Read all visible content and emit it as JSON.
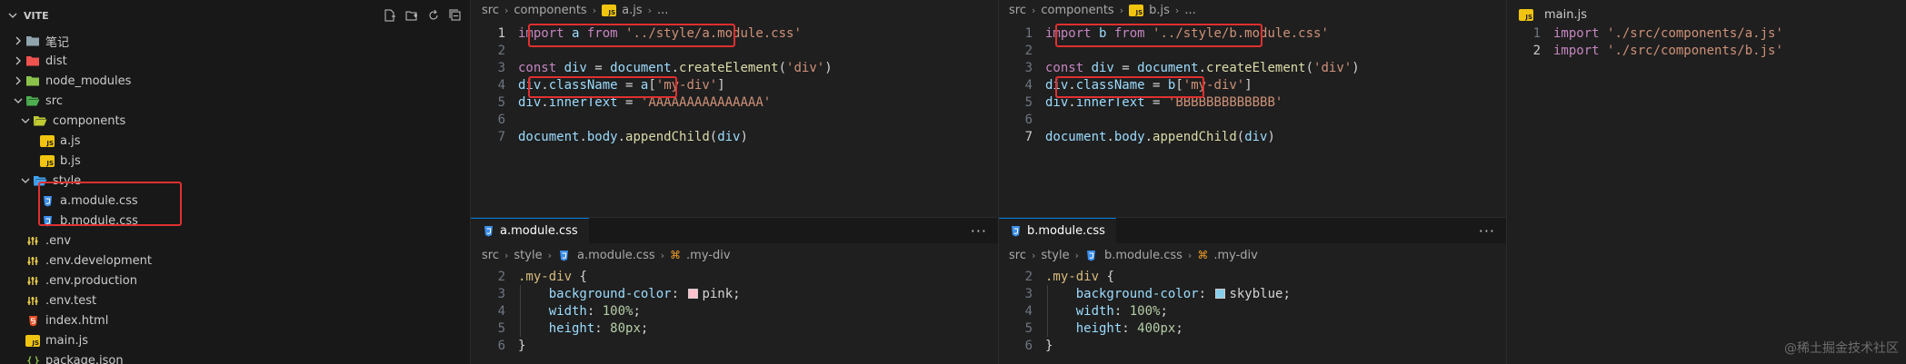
{
  "sidebar": {
    "title": "VITE",
    "actions": [
      "new-file-icon",
      "new-folder-icon",
      "refresh-icon",
      "collapse-icon"
    ],
    "items": [
      {
        "label": "笔记",
        "icon": "folder-icon",
        "kind": "folder-collapsed",
        "depth": 1
      },
      {
        "label": "dist",
        "icon": "folder-dist-icon",
        "kind": "folder-collapsed",
        "depth": 1
      },
      {
        "label": "node_modules",
        "icon": "folder-node-icon",
        "kind": "folder-collapsed",
        "depth": 1
      },
      {
        "label": "src",
        "icon": "folder-src-icon",
        "kind": "folder-open",
        "depth": 1
      },
      {
        "label": "components",
        "icon": "folder-components-icon",
        "kind": "folder-open",
        "depth": 2
      },
      {
        "label": "a.js",
        "icon": "js-file-icon",
        "kind": "file",
        "depth": 3
      },
      {
        "label": "b.js",
        "icon": "js-file-icon",
        "kind": "file",
        "depth": 3
      },
      {
        "label": "style",
        "icon": "folder-style-icon",
        "kind": "folder-open",
        "depth": 2
      },
      {
        "label": "a.module.css",
        "icon": "css-file-icon",
        "kind": "file",
        "depth": 3
      },
      {
        "label": "b.module.css",
        "icon": "css-file-icon",
        "kind": "file",
        "depth": 3
      },
      {
        "label": ".env",
        "icon": "env-file-icon",
        "kind": "file",
        "depth": 1
      },
      {
        "label": ".env.development",
        "icon": "env-file-icon",
        "kind": "file",
        "depth": 1
      },
      {
        "label": ".env.production",
        "icon": "env-file-icon",
        "kind": "file",
        "depth": 1
      },
      {
        "label": ".env.test",
        "icon": "env-file-icon",
        "kind": "file",
        "depth": 1
      },
      {
        "label": "index.html",
        "icon": "html-file-icon",
        "kind": "file",
        "depth": 1
      },
      {
        "label": "main.js",
        "icon": "js-file-icon",
        "kind": "file",
        "depth": 1
      },
      {
        "label": "package.json",
        "icon": "json-file-icon",
        "kind": "file",
        "depth": 1
      }
    ]
  },
  "editor_a_js": {
    "breadcrumb": [
      "src",
      "components",
      "a.js",
      "..."
    ],
    "lines": [
      {
        "n": "1",
        "parts": [
          [
            "kw",
            "import "
          ],
          [
            "var",
            "a "
          ],
          [
            "kw",
            "from "
          ],
          [
            "str",
            "'../style/a.module.css'"
          ]
        ]
      },
      {
        "n": "2",
        "parts": []
      },
      {
        "n": "3",
        "parts": [
          [
            "kw",
            "const "
          ],
          [
            "var",
            "div "
          ],
          [
            "pun",
            "= "
          ],
          [
            "var",
            "document"
          ],
          [
            "pun",
            "."
          ],
          [
            "fn",
            "createElement"
          ],
          [
            "pun",
            "("
          ],
          [
            "str",
            "'div'"
          ],
          [
            "pun",
            ")"
          ]
        ]
      },
      {
        "n": "4",
        "parts": [
          [
            "var",
            "div"
          ],
          [
            "pun",
            "."
          ],
          [
            "var",
            "className "
          ],
          [
            "pun",
            "= "
          ],
          [
            "var",
            "a"
          ],
          [
            "pun",
            "["
          ],
          [
            "str",
            "'my-div'"
          ],
          [
            "pun",
            "]"
          ]
        ]
      },
      {
        "n": "5",
        "parts": [
          [
            "var",
            "div"
          ],
          [
            "pun",
            "."
          ],
          [
            "var",
            "innerText "
          ],
          [
            "pun",
            "= "
          ],
          [
            "str",
            "'AAAAAAAAAAAAAAA'"
          ]
        ]
      },
      {
        "n": "6",
        "parts": []
      },
      {
        "n": "7",
        "parts": [
          [
            "var",
            "document"
          ],
          [
            "pun",
            "."
          ],
          [
            "var",
            "body"
          ],
          [
            "pun",
            "."
          ],
          [
            "fn",
            "appendChild"
          ],
          [
            "pun",
            "("
          ],
          [
            "var",
            "div"
          ],
          [
            "pun",
            ")"
          ]
        ]
      }
    ]
  },
  "editor_b_js": {
    "breadcrumb": [
      "src",
      "components",
      "b.js",
      "..."
    ],
    "lines": [
      {
        "n": "1",
        "parts": [
          [
            "kw",
            "import "
          ],
          [
            "var",
            "b "
          ],
          [
            "kw",
            "from "
          ],
          [
            "str",
            "'../style/b.module.css'"
          ]
        ]
      },
      {
        "n": "2",
        "parts": []
      },
      {
        "n": "3",
        "parts": [
          [
            "kw",
            "const "
          ],
          [
            "var",
            "div "
          ],
          [
            "pun",
            "= "
          ],
          [
            "var",
            "document"
          ],
          [
            "pun",
            "."
          ],
          [
            "fn",
            "createElement"
          ],
          [
            "pun",
            "("
          ],
          [
            "str",
            "'div'"
          ],
          [
            "pun",
            ")"
          ]
        ]
      },
      {
        "n": "4",
        "parts": [
          [
            "var",
            "div"
          ],
          [
            "pun",
            "."
          ],
          [
            "var",
            "className "
          ],
          [
            "pun",
            "= "
          ],
          [
            "var",
            "b"
          ],
          [
            "pun",
            "["
          ],
          [
            "str",
            "'my-div'"
          ],
          [
            "pun",
            "]"
          ]
        ]
      },
      {
        "n": "5",
        "parts": [
          [
            "var",
            "div"
          ],
          [
            "pun",
            "."
          ],
          [
            "var",
            "innerText "
          ],
          [
            "pun",
            "= "
          ],
          [
            "str",
            "'BBBBBBBBBBBBB'"
          ]
        ]
      },
      {
        "n": "6",
        "parts": []
      },
      {
        "n": "7",
        "parts": [
          [
            "var",
            "document"
          ],
          [
            "pun",
            "."
          ],
          [
            "var",
            "body"
          ],
          [
            "pun",
            "."
          ],
          [
            "fn",
            "appendChild"
          ],
          [
            "pun",
            "("
          ],
          [
            "var",
            "div"
          ],
          [
            "pun",
            ")"
          ]
        ]
      }
    ]
  },
  "editor_main_js": {
    "tab": "main.js",
    "lines": [
      {
        "n": "1",
        "parts": [
          [
            "kw",
            "import "
          ],
          [
            "str",
            "'./src/components/a.js'"
          ]
        ]
      },
      {
        "n": "2",
        "parts": [
          [
            "kw",
            "import "
          ],
          [
            "str",
            "'./src/components/b.js'"
          ]
        ]
      }
    ]
  },
  "editor_a_css": {
    "tab": "a.module.css",
    "more": "···",
    "breadcrumb": [
      "src",
      "style",
      "a.module.css",
      ".my-div"
    ],
    "lines": [
      {
        "n": "2",
        "parts": [
          [
            "sel",
            ".my-div "
          ],
          [
            "pun",
            "{"
          ]
        ]
      },
      {
        "n": "3",
        "parts": [
          [
            "pun",
            "    "
          ],
          [
            "prop",
            "background-color"
          ],
          [
            "pun",
            ": "
          ],
          [
            "swatch",
            "#ffc0cb"
          ],
          [
            "pun",
            "pink;"
          ]
        ]
      },
      {
        "n": "4",
        "parts": [
          [
            "pun",
            "    "
          ],
          [
            "prop",
            "width"
          ],
          [
            "pun",
            ": "
          ],
          [
            "num",
            "100%"
          ],
          [
            "pun",
            ";"
          ]
        ]
      },
      {
        "n": "5",
        "parts": [
          [
            "pun",
            "    "
          ],
          [
            "prop",
            "height"
          ],
          [
            "pun",
            ": "
          ],
          [
            "num",
            "80px"
          ],
          [
            "pun",
            ";"
          ]
        ]
      },
      {
        "n": "6",
        "parts": [
          [
            "pun",
            "}"
          ]
        ]
      }
    ]
  },
  "editor_b_css": {
    "tab": "b.module.css",
    "more": "···",
    "breadcrumb": [
      "src",
      "style",
      "b.module.css",
      ".my-div"
    ],
    "lines": [
      {
        "n": "2",
        "parts": [
          [
            "sel",
            ".my-div "
          ],
          [
            "pun",
            "{"
          ]
        ]
      },
      {
        "n": "3",
        "parts": [
          [
            "pun",
            "    "
          ],
          [
            "prop",
            "background-color"
          ],
          [
            "pun",
            ": "
          ],
          [
            "swatch",
            "#87ceeb"
          ],
          [
            "pun",
            "skyblue;"
          ]
        ]
      },
      {
        "n": "4",
        "parts": [
          [
            "pun",
            "    "
          ],
          [
            "prop",
            "width"
          ],
          [
            "pun",
            ": "
          ],
          [
            "num",
            "100%"
          ],
          [
            "pun",
            ";"
          ]
        ]
      },
      {
        "n": "5",
        "parts": [
          [
            "pun",
            "    "
          ],
          [
            "prop",
            "height"
          ],
          [
            "pun",
            ": "
          ],
          [
            "num",
            "400px"
          ],
          [
            "pun",
            ";"
          ]
        ]
      },
      {
        "n": "6",
        "parts": [
          [
            "pun",
            "}"
          ]
        ]
      }
    ]
  },
  "watermark": "@稀土掘金技术社区",
  "colors": {
    "highlight_box": "#e03030",
    "editor_bg": "#1f1f1f",
    "sidebar_bg": "#181818"
  }
}
